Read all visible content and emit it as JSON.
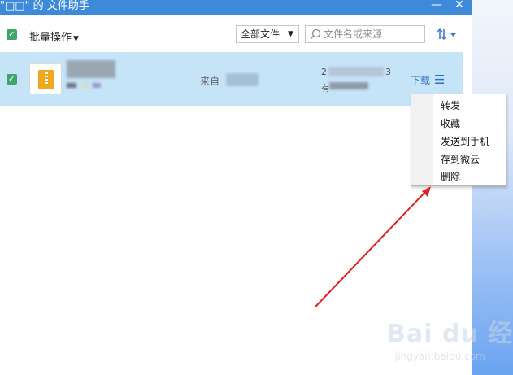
{
  "window": {
    "title": "\"□□\" 的 文件助手",
    "minimize_glyph": "—",
    "close_glyph": "✕"
  },
  "toolbar": {
    "batch_label": "批量操作",
    "filter_selected": "全部文件",
    "search_placeholder": "文件名或来源"
  },
  "file_row": {
    "checked": true,
    "icon": "zip-file-icon",
    "from_label": "来自",
    "date_prefix": "2",
    "date_suffix": "3",
    "size_prefix": "有",
    "download_label": "下载"
  },
  "context_menu": {
    "items": [
      "转发",
      "收藏",
      "发送到手机",
      "存到微云",
      "删除"
    ]
  },
  "watermark": {
    "brand": "Bai du 经验",
    "url": "jingyan.baidu.com"
  },
  "colors": {
    "titlebar": "#3d8ad9",
    "selected_row": "#c6e4f8",
    "link": "#2e6fbe",
    "checkbox": "#3ea66a",
    "arrow": "#e02020"
  }
}
